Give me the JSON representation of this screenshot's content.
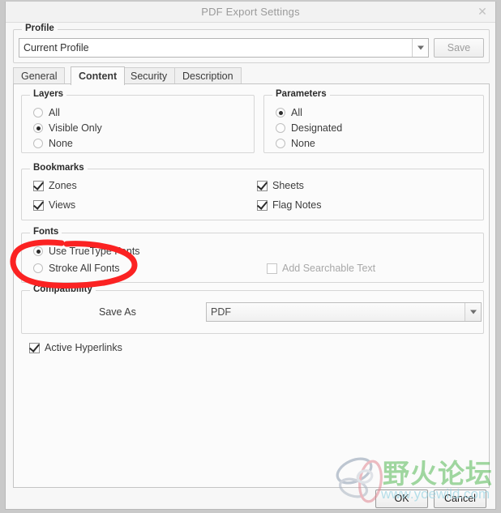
{
  "window": {
    "title": "PDF Export Settings",
    "close_icon": "close-icon"
  },
  "profile": {
    "legend": "Profile",
    "value": "Current Profile",
    "placeholder": "Current Profile",
    "save_label": "Save"
  },
  "tabs": [
    {
      "label": "General",
      "active": false
    },
    {
      "label": "Content",
      "active": true
    },
    {
      "label": "Security",
      "active": false
    },
    {
      "label": "Description",
      "active": false
    }
  ],
  "layers": {
    "legend": "Layers",
    "options": [
      {
        "label": "All",
        "selected": false
      },
      {
        "label": "Visible Only",
        "selected": true
      },
      {
        "label": "None",
        "selected": false
      }
    ]
  },
  "parameters": {
    "legend": "Parameters",
    "options": [
      {
        "label": "All",
        "selected": true
      },
      {
        "label": "Designated",
        "selected": false
      },
      {
        "label": "None",
        "selected": false
      }
    ]
  },
  "bookmarks": {
    "legend": "Bookmarks",
    "left": [
      {
        "label": "Zones",
        "checked": true
      },
      {
        "label": "Views",
        "checked": true
      }
    ],
    "right": [
      {
        "label": "Sheets",
        "checked": true
      },
      {
        "label": "Flag Notes",
        "checked": true
      }
    ]
  },
  "fonts": {
    "legend": "Fonts",
    "options": [
      {
        "label": "Use TrueType Fonts",
        "selected": true
      },
      {
        "label": "Stroke All Fonts",
        "selected": false
      }
    ],
    "searchable": {
      "label": "Add Searchable Text",
      "checked": false,
      "disabled": true
    }
  },
  "compatibility": {
    "legend": "Compatibility",
    "save_as_label": "Save As",
    "save_as_value": "PDF"
  },
  "hyperlinks": {
    "label": "Active Hyperlinks",
    "checked": true
  },
  "footer": {
    "ok_label": "OK",
    "cancel_label": "Cancel"
  },
  "watermark": {
    "cjk_text": "野火论坛",
    "url_text": "www.yoewild.com",
    "cjk_color": "#55b855",
    "url_color": "#9fd6e4"
  },
  "annotation": {
    "shape": "hand-drawn-ellipse",
    "color": "#fb2222",
    "targets": "Stroke All Fonts"
  }
}
